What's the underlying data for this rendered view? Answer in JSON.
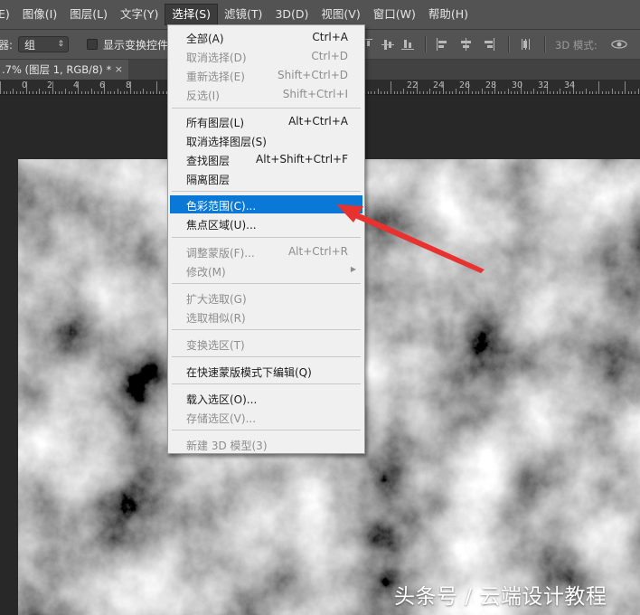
{
  "menubar": {
    "items": [
      {
        "label": "E)"
      },
      {
        "label": "图像(I)"
      },
      {
        "label": "图层(L)"
      },
      {
        "label": "文字(Y)"
      },
      {
        "label": "选择(S)"
      },
      {
        "label": "滤镜(T)"
      },
      {
        "label": "3D(D)"
      },
      {
        "label": "视图(V)"
      },
      {
        "label": "窗口(W)"
      },
      {
        "label": "帮助(H)"
      }
    ],
    "active": "选择(S)"
  },
  "options_bar": {
    "cut_label": "器:",
    "auto_select_value": "组",
    "show_transform_label": "显示变换控件",
    "show_transform_checked": false,
    "mode_3d_label": "3D 模式:"
  },
  "doc_tab": {
    "title": ".7% (图层 1, RGB/8) *",
    "close_symbol": "×"
  },
  "ruler": {
    "labels": [
      "0",
      "2",
      "4",
      "6",
      "8",
      "22",
      "24",
      "26",
      "28",
      "30",
      "32",
      "34"
    ]
  },
  "select_menu": {
    "items": [
      {
        "label": "全部(A)",
        "shortcut": "Ctrl+A",
        "enabled": true
      },
      {
        "label": "取消选择(D)",
        "shortcut": "Ctrl+D",
        "enabled": false
      },
      {
        "label": "重新选择(E)",
        "shortcut": "Shift+Ctrl+D",
        "enabled": false
      },
      {
        "label": "反选(I)",
        "shortcut": "Shift+Ctrl+I",
        "enabled": false
      },
      {
        "label": "所有图层(L)",
        "shortcut": "Alt+Ctrl+A",
        "enabled": true
      },
      {
        "label": "取消选择图层(S)",
        "shortcut": "",
        "enabled": true
      },
      {
        "label": "查找图层",
        "shortcut": "Alt+Shift+Ctrl+F",
        "enabled": true
      },
      {
        "label": "隔离图层",
        "shortcut": "",
        "enabled": true
      },
      {
        "label": "色彩范围(C)...",
        "shortcut": "",
        "enabled": true,
        "highlighted": true
      },
      {
        "label": "焦点区域(U)...",
        "shortcut": "",
        "enabled": true
      },
      {
        "label": "调整蒙版(F)...",
        "shortcut": "Alt+Ctrl+R",
        "enabled": false
      },
      {
        "label": "修改(M)",
        "shortcut": "",
        "enabled": false,
        "submenu": true
      },
      {
        "label": "扩大选取(G)",
        "shortcut": "",
        "enabled": false
      },
      {
        "label": "选取相似(R)",
        "shortcut": "",
        "enabled": false
      },
      {
        "label": "变换选区(T)",
        "shortcut": "",
        "enabled": false
      },
      {
        "label": "在快速蒙版模式下编辑(Q)",
        "shortcut": "",
        "enabled": true
      },
      {
        "label": "载入选区(O)...",
        "shortcut": "",
        "enabled": true
      },
      {
        "label": "存储选区(V)...",
        "shortcut": "",
        "enabled": false
      },
      {
        "label": "新建 3D 模型(3)",
        "shortcut": "",
        "enabled": false
      }
    ],
    "highlight_color": "#0a78d7"
  },
  "annotation": {
    "arrow_color": "#e8322f"
  },
  "watermark": {
    "text": "头条号 / 云端设计教程"
  }
}
